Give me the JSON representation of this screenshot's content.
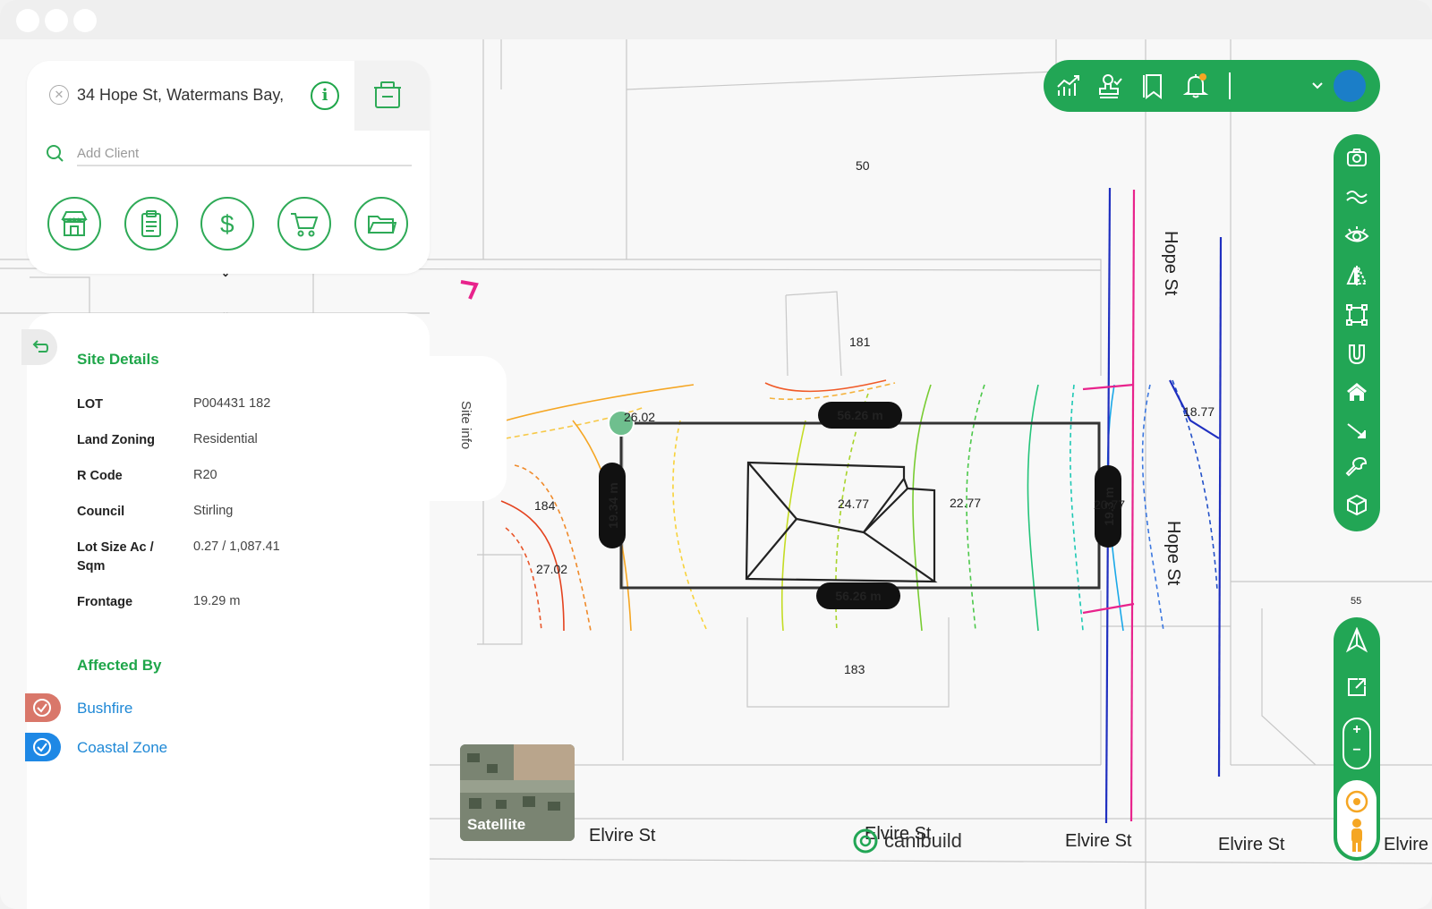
{
  "address": {
    "value": "34 Hope St, Watermans Bay,"
  },
  "client_search": {
    "placeholder": "Add Client"
  },
  "action_buttons": [
    {
      "icon": "store-icon"
    },
    {
      "icon": "clipboard-icon"
    },
    {
      "icon": "dollar-icon"
    },
    {
      "icon": "cart-icon"
    },
    {
      "icon": "folder-icon"
    }
  ],
  "site_details": {
    "title": "Site Details",
    "rows": [
      {
        "label": "LOT",
        "value": "P004431 182"
      },
      {
        "label": "Land Zoning",
        "value": "Residential"
      },
      {
        "label": "R Code",
        "value": "R20"
      },
      {
        "label": "Council",
        "value": "Stirling"
      },
      {
        "label": "Lot Size Ac / Sqm",
        "value": "0.27 / 1,087.41"
      },
      {
        "label": "Frontage",
        "value": "19.29 m"
      }
    ]
  },
  "affected_by": {
    "title": "Affected By",
    "items": [
      {
        "label": "Bushfire",
        "color": "#d9776a"
      },
      {
        "label": "Coastal Zone",
        "color": "#1e88e5"
      }
    ]
  },
  "site_info_tab": "Site info",
  "map": {
    "lot_labels": {
      "a": "50",
      "b": "181",
      "c": "184",
      "d": "183",
      "e": "55"
    },
    "levels": {
      "l1": "26.02",
      "l2": "27.02",
      "l3": "24.77",
      "l4": "22.77",
      "l5": "20.77",
      "l6": "18.77"
    },
    "dims": {
      "top": "56.26 m",
      "bottom": "56.26 m",
      "left": "19.34 m",
      "right": "19.3 m"
    },
    "streets": {
      "s1": "Elvire St",
      "s2": "Elvire St",
      "s3": "Elvire St",
      "s4": "Elvire St",
      "s5": "Elvire St",
      "v1": "Hope St",
      "v2": "Hope St"
    }
  },
  "satellite_label": "Satellite",
  "logo_text": "canibuild",
  "colors": {
    "brand_green": "#22a655",
    "avatar_blue": "#1b7ec8"
  }
}
